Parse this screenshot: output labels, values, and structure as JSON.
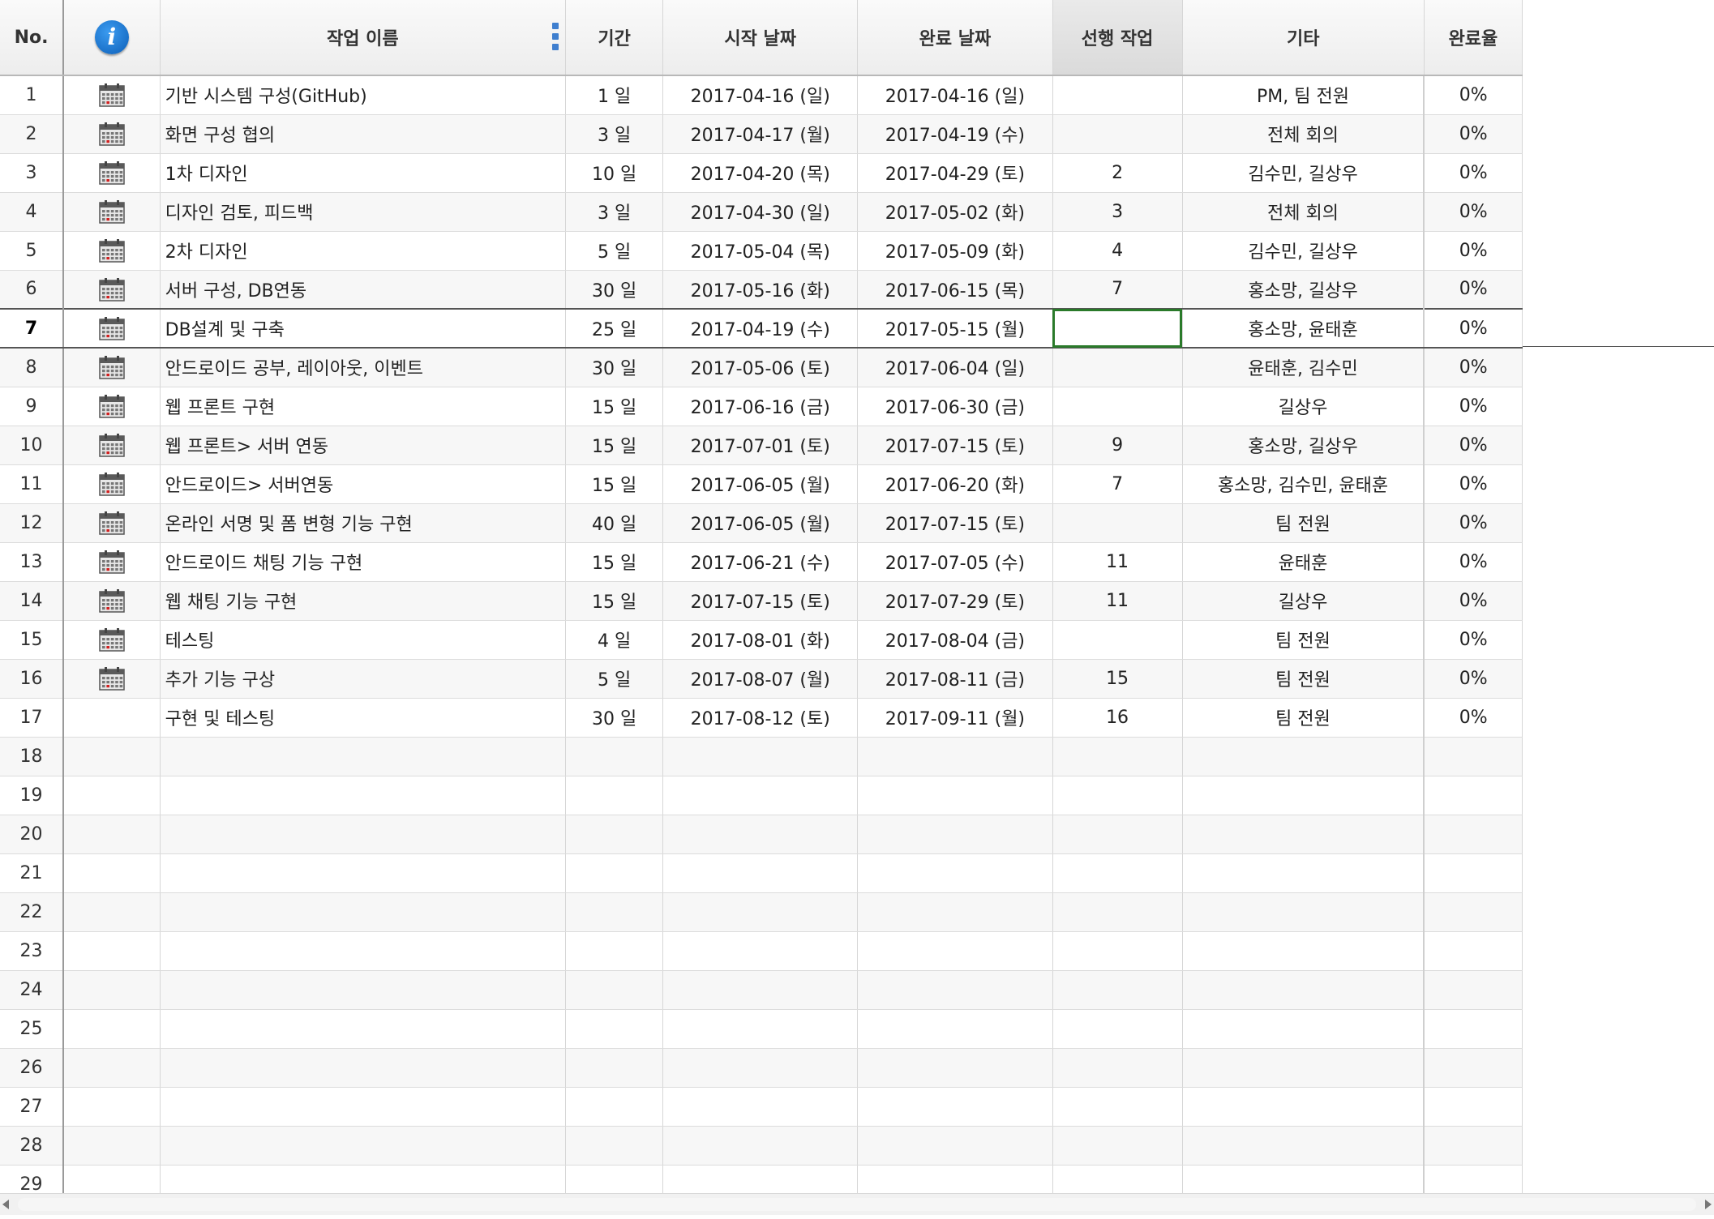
{
  "headers": {
    "no": "No.",
    "info_icon": "info-icon",
    "name": "작업 이름",
    "duration": "기간",
    "start": "시작 날짜",
    "end": "완료 날짜",
    "predecessor": "선행 작업",
    "note": "기타",
    "percent": "완료율"
  },
  "colors": {
    "selection_border": "#2a7a2a",
    "info_icon": "#1a73d6",
    "menu_dots": "#3f7fcf"
  },
  "active_row": 7,
  "selected_cell": {
    "row": 7,
    "column": "predecessor"
  },
  "tasks": [
    {
      "no": "1",
      "name": "기반 시스템 구성(GitHub)",
      "duration": "1 일",
      "start": "2017-04-16 (일)",
      "end": "2017-04-16 (일)",
      "pred": "",
      "note": "PM, 팀 전원",
      "pct": "0%",
      "icon": "calendar-icon"
    },
    {
      "no": "2",
      "name": "화면 구성 협의",
      "duration": "3 일",
      "start": "2017-04-17 (월)",
      "end": "2017-04-19 (수)",
      "pred": "",
      "note": "전체 회의",
      "pct": "0%",
      "icon": "calendar-icon"
    },
    {
      "no": "3",
      "name": "1차 디자인",
      "duration": "10 일",
      "start": "2017-04-20 (목)",
      "end": "2017-04-29 (토)",
      "pred": "2",
      "note": "김수민, 길상우",
      "pct": "0%",
      "icon": "calendar-icon"
    },
    {
      "no": "4",
      "name": "디자인 검토, 피드백",
      "duration": "3 일",
      "start": "2017-04-30 (일)",
      "end": "2017-05-02 (화)",
      "pred": "3",
      "note": "전체 회의",
      "pct": "0%",
      "icon": "calendar-icon"
    },
    {
      "no": "5",
      "name": "2차 디자인",
      "duration": "5 일",
      "start": "2017-05-04 (목)",
      "end": "2017-05-09 (화)",
      "pred": "4",
      "note": "김수민, 길상우",
      "pct": "0%",
      "icon": "calendar-icon"
    },
    {
      "no": "6",
      "name": "서버 구성, DB연동",
      "duration": "30 일",
      "start": "2017-05-16 (화)",
      "end": "2017-06-15 (목)",
      "pred": "7",
      "note": "홍소망, 길상우",
      "pct": "0%",
      "icon": "calendar-icon"
    },
    {
      "no": "7",
      "name": "DB설계 및 구축",
      "duration": "25 일",
      "start": "2017-04-19 (수)",
      "end": "2017-05-15 (월)",
      "pred": "",
      "note": "홍소망, 윤태훈",
      "pct": "0%",
      "icon": "calendar-icon"
    },
    {
      "no": "8",
      "name": "안드로이드 공부, 레이아웃, 이벤트",
      "duration": "30 일",
      "start": "2017-05-06 (토)",
      "end": "2017-06-04 (일)",
      "pred": "",
      "note": "윤태훈, 김수민",
      "pct": "0%",
      "icon": "calendar-icon"
    },
    {
      "no": "9",
      "name": "웹 프론트 구현",
      "duration": "15 일",
      "start": "2017-06-16 (금)",
      "end": "2017-06-30 (금)",
      "pred": "",
      "note": "길상우",
      "pct": "0%",
      "icon": "calendar-icon"
    },
    {
      "no": "10",
      "name": "웹 프론트> 서버 연동",
      "duration": "15 일",
      "start": "2017-07-01 (토)",
      "end": "2017-07-15 (토)",
      "pred": "9",
      "note": "홍소망, 길상우",
      "pct": "0%",
      "icon": "calendar-icon"
    },
    {
      "no": "11",
      "name": "안드로이드> 서버연동",
      "duration": "15 일",
      "start": "2017-06-05 (월)",
      "end": "2017-06-20 (화)",
      "pred": "7",
      "note": "홍소망, 김수민, 윤태훈",
      "pct": "0%",
      "icon": "calendar-icon"
    },
    {
      "no": "12",
      "name": "온라인 서명 및 폼 변형 기능 구현",
      "duration": "40 일",
      "start": "2017-06-05 (월)",
      "end": "2017-07-15 (토)",
      "pred": "",
      "note": "팀 전원",
      "pct": "0%",
      "icon": "calendar-icon"
    },
    {
      "no": "13",
      "name": "안드로이드 채팅 기능 구현",
      "duration": "15 일",
      "start": "2017-06-21 (수)",
      "end": "2017-07-05 (수)",
      "pred": "11",
      "note": "윤태훈",
      "pct": "0%",
      "icon": "calendar-icon"
    },
    {
      "no": "14",
      "name": "웹 채팅 기능 구현",
      "duration": "15 일",
      "start": "2017-07-15 (토)",
      "end": "2017-07-29 (토)",
      "pred": "11",
      "note": "길상우",
      "pct": "0%",
      "icon": "calendar-icon"
    },
    {
      "no": "15",
      "name": "테스팅",
      "duration": "4 일",
      "start": "2017-08-01 (화)",
      "end": "2017-08-04 (금)",
      "pred": "",
      "note": "팀 전원",
      "pct": "0%",
      "icon": "calendar-icon"
    },
    {
      "no": "16",
      "name": "추가 기능 구상",
      "duration": "5 일",
      "start": "2017-08-07 (월)",
      "end": "2017-08-11 (금)",
      "pred": "15",
      "note": "팀 전원",
      "pct": "0%",
      "icon": "calendar-icon"
    },
    {
      "no": "17",
      "name": "구현 및 테스팅",
      "duration": "30 일",
      "start": "2017-08-12 (토)",
      "end": "2017-09-11 (월)",
      "pred": "16",
      "note": "팀 전원",
      "pct": "0%",
      "icon": ""
    }
  ],
  "empty_rows": [
    "18",
    "19",
    "20",
    "21",
    "22",
    "23",
    "24",
    "25",
    "26",
    "27",
    "28",
    "29"
  ]
}
